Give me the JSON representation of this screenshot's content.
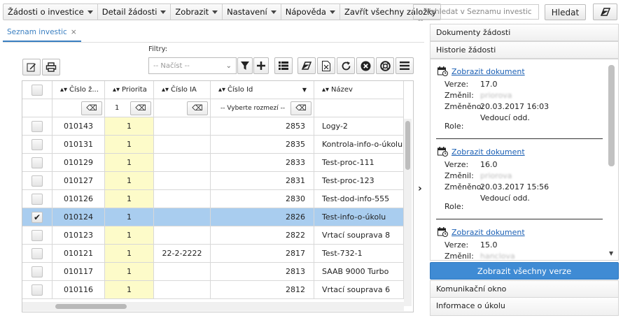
{
  "menu": [
    {
      "label": "Žádosti o investice"
    },
    {
      "label": "Detail žádosti"
    },
    {
      "label": "Zobrazit"
    },
    {
      "label": "Nastavení"
    },
    {
      "label": "Nápověda"
    },
    {
      "label": "Zavřít všechny záložky"
    }
  ],
  "search": {
    "placeholder": "-- Vyhledat v Seznamu investic --",
    "button": "Hledat"
  },
  "tab": {
    "label": "Seznam investic",
    "close": "×"
  },
  "filters": {
    "label": "Filtry:",
    "load_placeholder": "-- Načíst --"
  },
  "grid": {
    "headers": [
      "Číslo ž...",
      "Priorita",
      "Číslo IA",
      "Číslo Id",
      "Název"
    ],
    "filter_values": {
      "priority": "1",
      "id_select": "-- Vyberte rozmezí --"
    },
    "rows": [
      {
        "cislo": "010143",
        "priorita": "1",
        "ia": "",
        "id": "2853",
        "nazev": "Logy-2",
        "checked": false
      },
      {
        "cislo": "010131",
        "priorita": "1",
        "ia": "",
        "id": "2835",
        "nazev": "Kontrola-info-o-úkolu",
        "checked": false
      },
      {
        "cislo": "010129",
        "priorita": "1",
        "ia": "",
        "id": "2833",
        "nazev": "Test-proc-111",
        "checked": false
      },
      {
        "cislo": "010127",
        "priorita": "1",
        "ia": "",
        "id": "2831",
        "nazev": "Test-proc-123",
        "checked": false
      },
      {
        "cislo": "010126",
        "priorita": "1",
        "ia": "",
        "id": "2830",
        "nazev": "Test-dod-info-555",
        "checked": false
      },
      {
        "cislo": "010124",
        "priorita": "1",
        "ia": "",
        "id": "2826",
        "nazev": "Test-info-o-úkolu",
        "checked": true
      },
      {
        "cislo": "010123",
        "priorita": "1",
        "ia": "",
        "id": "2822",
        "nazev": "Vrtací souprava 8",
        "checked": false
      },
      {
        "cislo": "010121",
        "priorita": "1",
        "ia": "22-2-2222",
        "id": "2817",
        "nazev": "Test-732-1",
        "checked": false
      },
      {
        "cislo": "010117",
        "priorita": "1",
        "ia": "",
        "id": "2813",
        "nazev": "SAAB 9000 Turbo",
        "checked": false
      },
      {
        "cislo": "010116",
        "priorita": "1",
        "ia": "",
        "id": "2812",
        "nazev": "Vrtací souprava 6",
        "checked": false
      }
    ]
  },
  "right_panel": {
    "sections_top": [
      "Dokumenty žádosti",
      "Historie žádosti"
    ],
    "history": [
      {
        "link": "Zobrazit dokument",
        "labels": {
          "verze": "Verze:",
          "zmenil": "Změnil:",
          "zmeneno": "Změněno:",
          "role": "Role:"
        },
        "verze": "17.0",
        "zmenil": "priorova",
        "zmeneno": "20.03.2017 16:03",
        "role": "Vedoucí odd."
      },
      {
        "link": "Zobrazit dokument",
        "labels": {
          "verze": "Verze:",
          "zmenil": "Změnil:",
          "zmeneno": "Změněno:",
          "role": "Role:"
        },
        "verze": "16.0",
        "zmenil": "priorova",
        "zmeneno": "20.03.2017 15:56",
        "role": "Vedoucí odd."
      },
      {
        "link": "Zobrazit dokument",
        "labels": {
          "verze": "Verze:",
          "zmenil": "Změnil:",
          "zmeneno": "",
          "role": ""
        },
        "verze": "15.0",
        "zmenil": "hanclova",
        "zmeneno": "",
        "role": ""
      }
    ],
    "show_all_button": "Zobrazit všechny verze",
    "sections_bottom": [
      "Komunikační okno",
      "Informace o úkolu"
    ]
  },
  "colors": {
    "accent": "#3f8bd4",
    "selected_row": "#a9cdef",
    "priority_bg": "#fdfbc9",
    "link": "#1a5fb4"
  }
}
